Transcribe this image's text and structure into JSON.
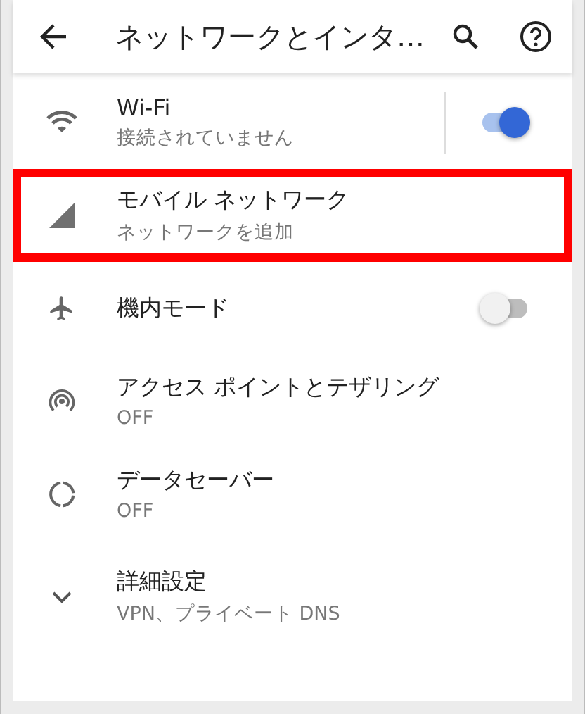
{
  "header": {
    "title": "ネットワークとインタ…"
  },
  "items": [
    {
      "kind": "toggle",
      "title": "Wi-Fi",
      "summary": "接続されていません",
      "on": true,
      "divider": true,
      "highlighted": false
    },
    {
      "kind": "plain",
      "title": "モバイル ネットワーク",
      "summary": "ネットワークを追加",
      "highlighted": true
    },
    {
      "kind": "toggle",
      "title": "機内モード",
      "on": false,
      "divider": false,
      "highlighted": false
    },
    {
      "kind": "plain",
      "title": "アクセス ポイントとテザリング",
      "summary": "OFF",
      "highlighted": false
    },
    {
      "kind": "plain",
      "title": "データセーバー",
      "summary": "OFF",
      "highlighted": false
    },
    {
      "kind": "plain",
      "title": "詳細設定",
      "summary": "VPN、プライベート DNS",
      "highlighted": false
    }
  ]
}
